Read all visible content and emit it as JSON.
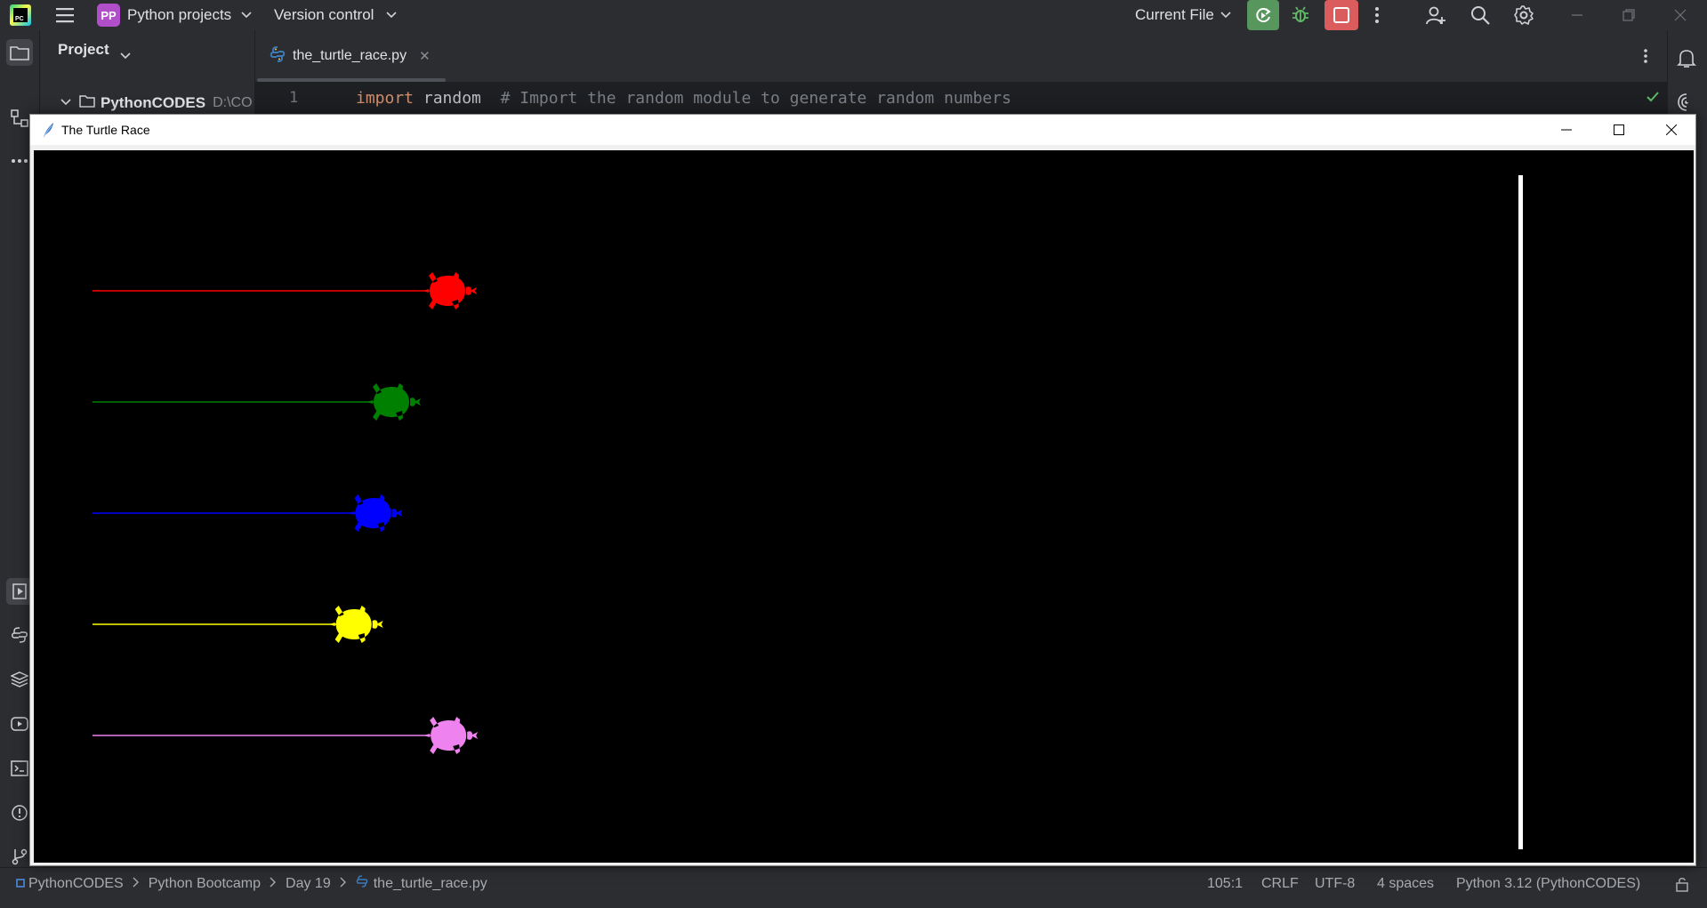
{
  "ide": {
    "logo_text": "PC",
    "project_badge": "PP",
    "project_name": "Python projects",
    "vcs_label": "Version control",
    "run_config": "Current File"
  },
  "project_panel": {
    "title": "Project",
    "root_label": "PythonCODES",
    "root_path": "D:\\CO"
  },
  "editor": {
    "tab_name": "the_turtle_race.py",
    "line_number": "1",
    "code_keyword": "import",
    "code_identifier": " random",
    "code_comment": "  # Import the random module to generate random numbers"
  },
  "status_bar": {
    "breadcrumbs": [
      "PythonCODES",
      "Python Bootcamp",
      "Day 19",
      "the_turtle_race.py"
    ],
    "position": "105:1",
    "line_sep": "CRLF",
    "encoding": "UTF-8",
    "indent": "4 spaces",
    "interpreter": "Python 3.12 (PythonCODES)"
  },
  "turtle_window": {
    "title": "The Turtle Race"
  },
  "race": {
    "track_start": 0,
    "finish_line": 1400,
    "turtles": [
      {
        "color": "red",
        "hex": "#ff0000",
        "distance": 345
      },
      {
        "color": "green",
        "hex": "#008000",
        "distance": 290
      },
      {
        "color": "blue",
        "hex": "#0000ff",
        "distance": 272
      },
      {
        "color": "yellow",
        "hex": "#ffff00",
        "distance": 253
      },
      {
        "color": "violet",
        "hex": "#ee82ee",
        "distance": 346
      }
    ]
  },
  "colors": {
    "ide_bg": "#2b2d30",
    "editor_bg": "#1e1f22",
    "run_green": "#57965c",
    "stop_red": "#db5c5c",
    "canvas_bg": "#000000"
  }
}
